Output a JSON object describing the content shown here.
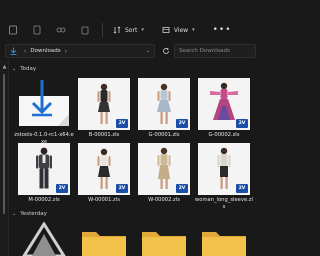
{
  "toolbar": {
    "new_icon": "new-item-icon",
    "cut_icon": "cut-icon",
    "copy_icon": "copy-icon",
    "paste_icon": "paste-icon",
    "sort_label": "Sort",
    "view_label": "View",
    "more_icon": "more-options-icon"
  },
  "address": {
    "download_icon": "download-arrow-icon",
    "path": [
      "Downloads"
    ],
    "search_placeholder": "Search Downloads"
  },
  "groups": [
    {
      "label": "Today",
      "items": [
        {
          "name": "zstools-0.1.0-rc1-x64.exe",
          "type": "exe"
        },
        {
          "name": "B-00001.zls",
          "type": "zls",
          "badge": "2V",
          "figure": "dark-dress"
        },
        {
          "name": "G-00001.zls",
          "type": "zls",
          "badge": "2V",
          "figure": "light-dress"
        },
        {
          "name": "G-00002.zls",
          "type": "zls",
          "badge": "2V",
          "figure": "pink-gown"
        },
        {
          "name": "M-00002.zls",
          "type": "zls",
          "badge": "2V",
          "figure": "suit"
        },
        {
          "name": "W-00001.zls",
          "type": "zls",
          "badge": "2V",
          "figure": "dark-skirt"
        },
        {
          "name": "W-00002.zls",
          "type": "zls",
          "badge": "2V",
          "figure": "tan-dress"
        },
        {
          "name": "woman_long_sleeve.zls",
          "type": "zls",
          "badge": "2V",
          "figure": "long-sleeve"
        }
      ]
    },
    {
      "label": "Yesterday",
      "items": [
        {
          "name": "",
          "type": "app-icon"
        },
        {
          "name": "",
          "type": "folder"
        },
        {
          "name": "",
          "type": "folder"
        },
        {
          "name": "",
          "type": "folder"
        }
      ]
    }
  ],
  "colors": {
    "background": "#191919",
    "accent_badge": "#1b4fa8",
    "download_icon": "#2d8ee0",
    "folder": "#f2c14a"
  }
}
